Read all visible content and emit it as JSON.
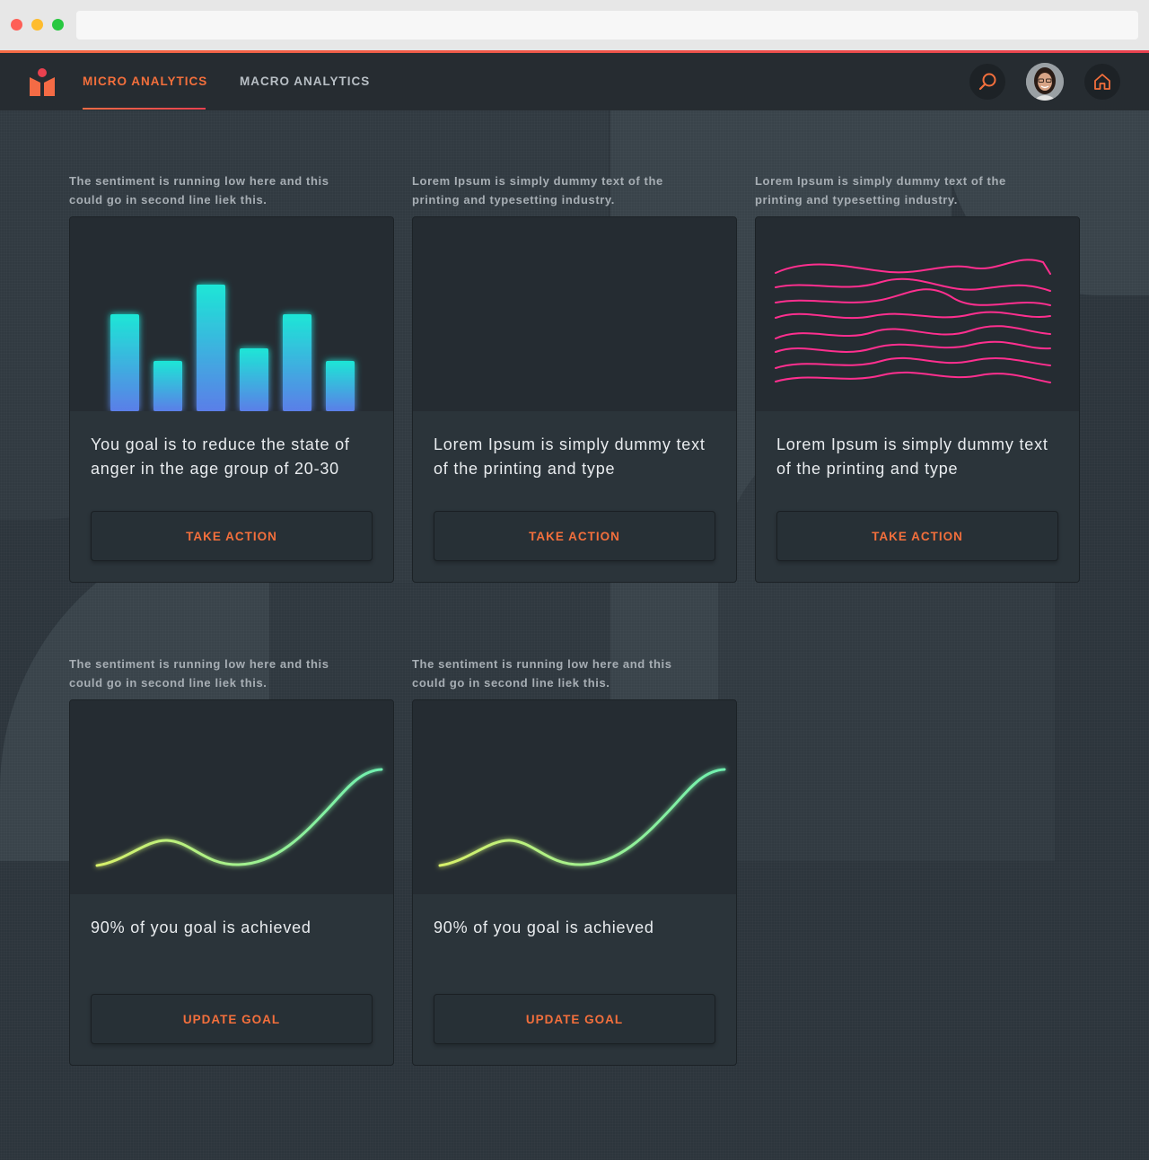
{
  "nav": {
    "tabs": [
      {
        "label": "MICRO ANALYTICS",
        "active": true
      },
      {
        "label": "MACRO ANALYTICS",
        "active": false
      }
    ],
    "icons": [
      "search-icon",
      "avatar",
      "home-icon"
    ]
  },
  "colors": {
    "accent": "#f36f3c",
    "background": "#2c353c",
    "card": "#2b343a",
    "bars": "#1de2d6",
    "waves": "#ff2f8f",
    "curve": "#7ff0b0"
  },
  "cards": [
    {
      "caption": "The sentiment is running low here and this could go in second line liek this.",
      "description": "You goal is to reduce the state of anger in the age group of 20-30",
      "action": "TAKE ACTION",
      "viz": "bar-chart"
    },
    {
      "caption": "Lorem Ipsum is simply dummy text of the printing and typesetting industry.",
      "description": "Lorem Ipsum is simply dummy text of the printing and type",
      "action": "TAKE ACTION",
      "viz": "line-bars"
    },
    {
      "caption": "Lorem Ipsum is simply dummy text of the printing and typesetting industry.",
      "description": "Lorem Ipsum is simply dummy text of the printing and type",
      "action": "TAKE ACTION",
      "viz": "waves"
    },
    {
      "caption": "The sentiment is running low here and this could go in second line liek this.",
      "description": "90% of you goal is achieved",
      "action": "UPDATE GOAL",
      "viz": "curve"
    },
    {
      "caption": "The sentiment is running low here and this could go in second line liek this.",
      "description": "90% of you goal is achieved",
      "action": "UPDATE GOAL",
      "viz": "curve"
    }
  ]
}
